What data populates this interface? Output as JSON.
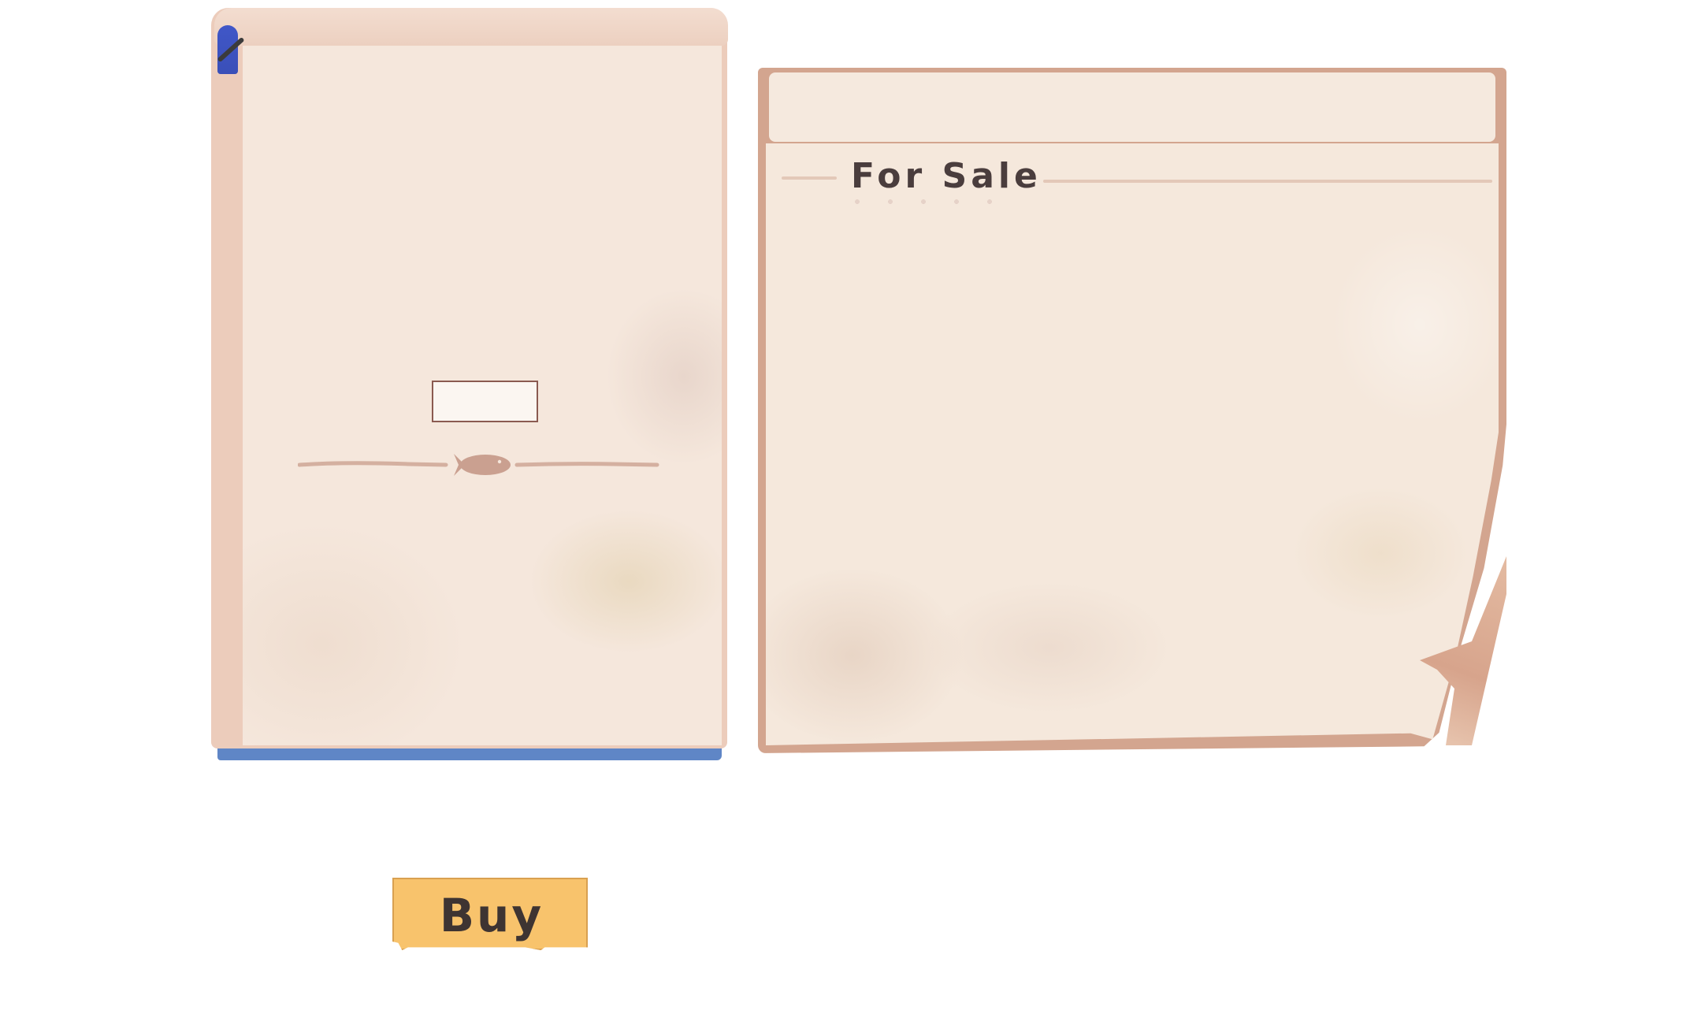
{
  "sale_board": {
    "title": "For Sale"
  },
  "notebook": {
    "input_value": "",
    "divider_icon": "fish-icon"
  },
  "actions": {
    "buy_label": "Buy"
  },
  "colors": {
    "paper": "#f5e7dc",
    "board_frame": "#d3a58f",
    "notebook_cover": "#4f66c4",
    "buy_button": "#f8c36c",
    "text_dark": "#4a3d3d"
  }
}
